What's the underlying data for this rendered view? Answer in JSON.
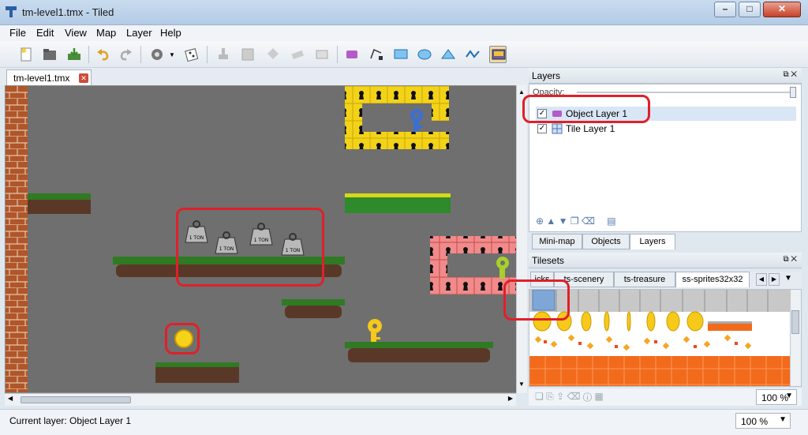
{
  "window": {
    "title": "tm-level1.tmx - Tiled",
    "min": "–",
    "max": "□",
    "close": "✕"
  },
  "menu": [
    "File",
    "Edit",
    "View",
    "Map",
    "Layer",
    "Help"
  ],
  "document_tab": {
    "label": "tm-level1.tmx",
    "close": "✕"
  },
  "layers_panel": {
    "title": "Layers",
    "opacity_label": "Opacity:",
    "layers": [
      {
        "name": "Object Layer 1",
        "checked": true,
        "type": "object"
      },
      {
        "name": "Tile Layer 1",
        "checked": true,
        "type": "tile"
      }
    ],
    "tabs": [
      "Mini-map",
      "Objects",
      "Layers"
    ],
    "active_tab": "Layers"
  },
  "tilesets_panel": {
    "title": "Tilesets",
    "tabs": [
      "icks",
      "ts-scenery",
      "ts-treasure",
      "ss-sprites32x32"
    ],
    "active_tab": "ss-sprites32x32",
    "zoom": "100 %"
  },
  "status": {
    "current_layer": "Current layer: Object Layer 1",
    "zoom": "100 %"
  },
  "map": {
    "weight_label": "1 TON"
  },
  "colors": {
    "accent_red": "#e0202a",
    "canvas_bg": "#6f6f6f"
  }
}
